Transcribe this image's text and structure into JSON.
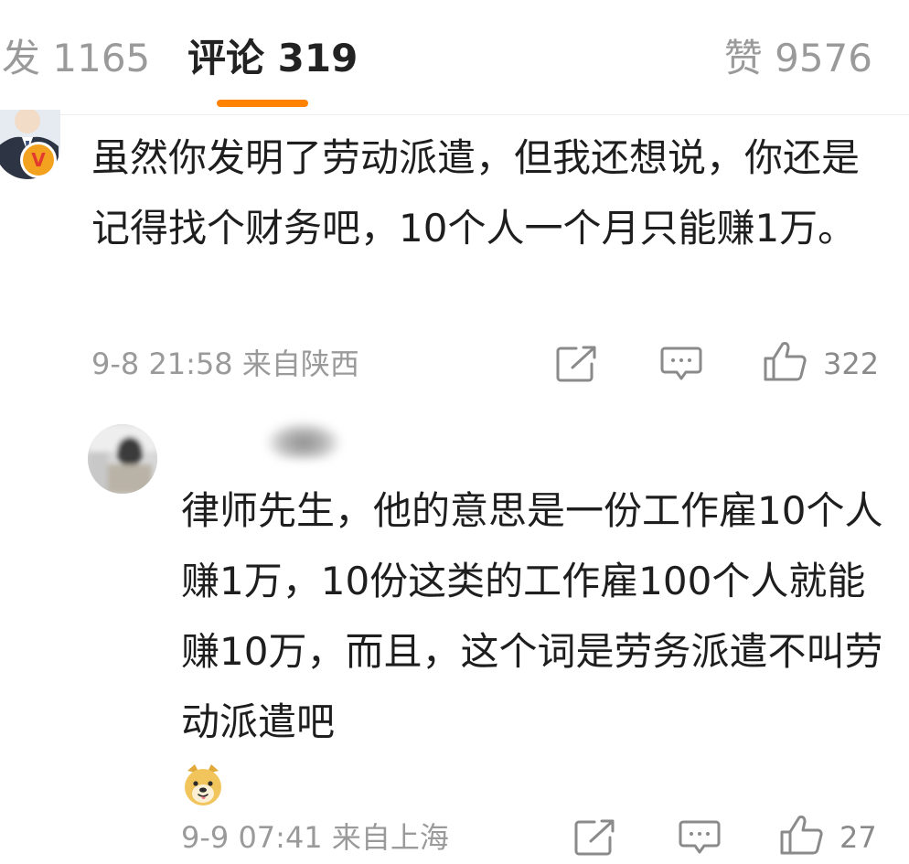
{
  "tabs": {
    "repost": {
      "label": "发",
      "count": "1165"
    },
    "comments": {
      "label": "评论",
      "count": "319"
    },
    "likes": {
      "label": "赞",
      "count": "9576"
    },
    "active_color": "#ff8200"
  },
  "comment": {
    "avatar_icon": "verified-user-avatar",
    "badge_icon": "vip-v-icon",
    "text": "虽然你发明了劳动派遣，但我还想说，你还是记得找个财务吧，10个人一个月只能赚1万。",
    "time": "9-8 21:58",
    "location": "来自陕西",
    "like_count": "322"
  },
  "reply": {
    "avatar_icon": "blurred-user-avatar",
    "username": "",
    "text": "律师先生，他的意思是一份工作雇10个人赚1万，10份这类的工作雇100个人就能赚10万，而且，这个词是劳务派遣不叫劳动派遣吧",
    "emoji_icon": "doge-emoji-icon",
    "time": "9-9 07:41",
    "location": "来自上海",
    "like_count": "27"
  }
}
